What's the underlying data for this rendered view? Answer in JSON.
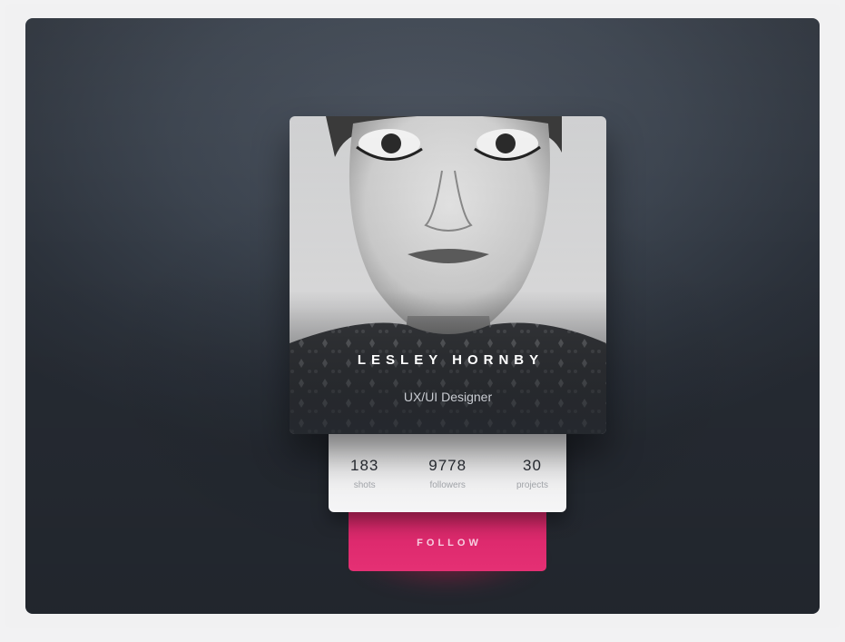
{
  "profile": {
    "name": "LESLEY HORNBY",
    "role": "UX/UI Designer"
  },
  "stats": [
    {
      "value": "183",
      "label": "shots"
    },
    {
      "value": "9778",
      "label": "followers"
    },
    {
      "value": "30",
      "label": "projects"
    }
  ],
  "actions": {
    "follow_label": "FOLLOW"
  },
  "colors": {
    "background": "#2f353e",
    "accent": "#e0296e",
    "panel": "#f2f2f3"
  }
}
